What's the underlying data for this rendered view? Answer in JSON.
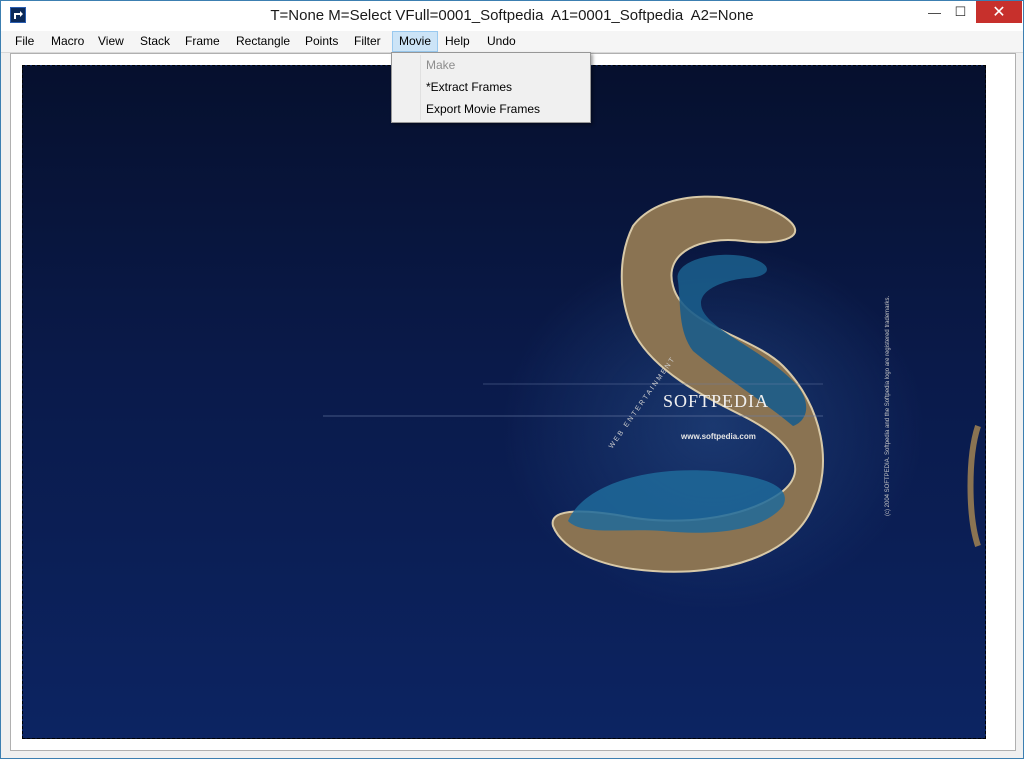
{
  "window": {
    "title": "T=None M=Select VFull=0001_Softpedia  A1=0001_Softpedia  A2=None",
    "app_icon": "app-icon",
    "controls": {
      "minimize": "—",
      "maximize": "☐",
      "close": "✕"
    }
  },
  "menubar": {
    "items": [
      "File",
      "Macro",
      "View",
      "Stack",
      "Frame",
      "Rectangle",
      "Points",
      "Filter",
      "Movie",
      "Help",
      "Undo"
    ],
    "active": "Movie"
  },
  "movie_menu": {
    "items": [
      {
        "label": "Make",
        "enabled": false
      },
      {
        "label": "*Extract Frames",
        "enabled": true
      },
      {
        "label": "Export Movie Frames",
        "enabled": true
      }
    ]
  },
  "image": {
    "brand": "SOFTPEDIA",
    "url": "www.softpedia.com",
    "tagline": "WEB ENTERTAINMENT",
    "copyright": "(c) 2004 SOFTPEDIA. Softpedia and the Softpedia logo are registered trademarks."
  },
  "colors": {
    "close_button": "#c7302c",
    "menu_highlight": "#cce4f7",
    "image_background": "#0a1a4a"
  }
}
